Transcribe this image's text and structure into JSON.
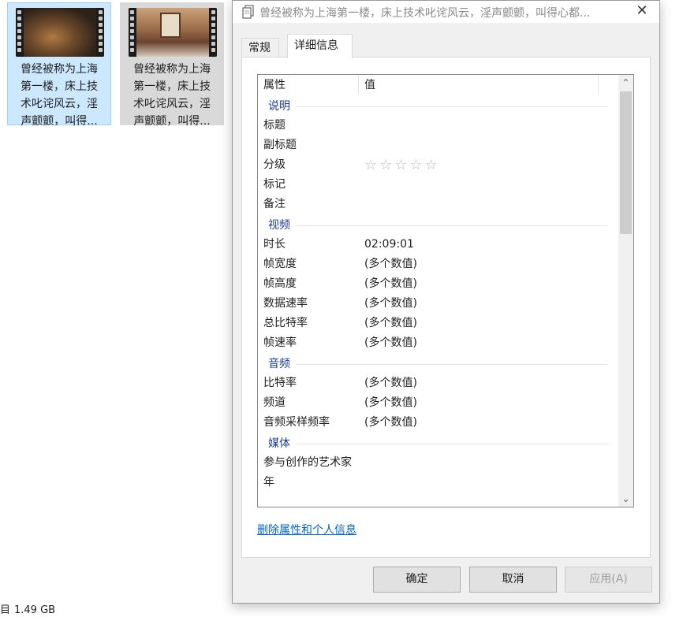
{
  "explorer": {
    "files": [
      {
        "name_lines": "曾经被称为上海\n第一楼，床上技\n术叱诧风云，淫\n声颤颤，叫得..."
      },
      {
        "name_lines": "曾经被称为上海\n第一楼，床上技\n术叱诧风云，淫\n声颤颤，叫得..."
      }
    ],
    "status": {
      "icon": "目",
      "size": "1.49 GB"
    }
  },
  "dialog": {
    "title": "曾经被称为上海第一楼，床上技术叱诧风云，淫声颤颤，叫得心都...",
    "tabs": [
      {
        "label": "常规"
      },
      {
        "label": "详细信息"
      }
    ],
    "columns": {
      "property": "属性",
      "value": "值"
    },
    "groups": {
      "description": {
        "label": "说明",
        "rows": [
          {
            "k": "标题",
            "v": ""
          },
          {
            "k": "副标题",
            "v": ""
          },
          {
            "k": "分级",
            "v": ""
          },
          {
            "k": "标记",
            "v": ""
          },
          {
            "k": "备注",
            "v": ""
          }
        ],
        "rating_stars": "☆☆☆☆☆"
      },
      "video": {
        "label": "视频",
        "rows": [
          {
            "k": "时长",
            "v": "02:09:01"
          },
          {
            "k": "帧宽度",
            "v": "(多个数值)"
          },
          {
            "k": "帧高度",
            "v": "(多个数值)"
          },
          {
            "k": "数据速率",
            "v": "(多个数值)"
          },
          {
            "k": "总比特率",
            "v": "(多个数值)"
          },
          {
            "k": "帧速率",
            "v": "(多个数值)"
          }
        ]
      },
      "audio": {
        "label": "音频",
        "rows": [
          {
            "k": "比特率",
            "v": "(多个数值)"
          },
          {
            "k": "频道",
            "v": "(多个数值)"
          },
          {
            "k": "音频采样频率",
            "v": "(多个数值)"
          }
        ]
      },
      "media": {
        "label": "媒体",
        "rows": [
          {
            "k": "参与创作的艺术家",
            "v": ""
          },
          {
            "k": "年",
            "v": ""
          }
        ]
      }
    },
    "remove_link": "删除属性和个人信息",
    "buttons": {
      "ok": "确定",
      "cancel": "取消",
      "apply": "应用(A)"
    }
  }
}
